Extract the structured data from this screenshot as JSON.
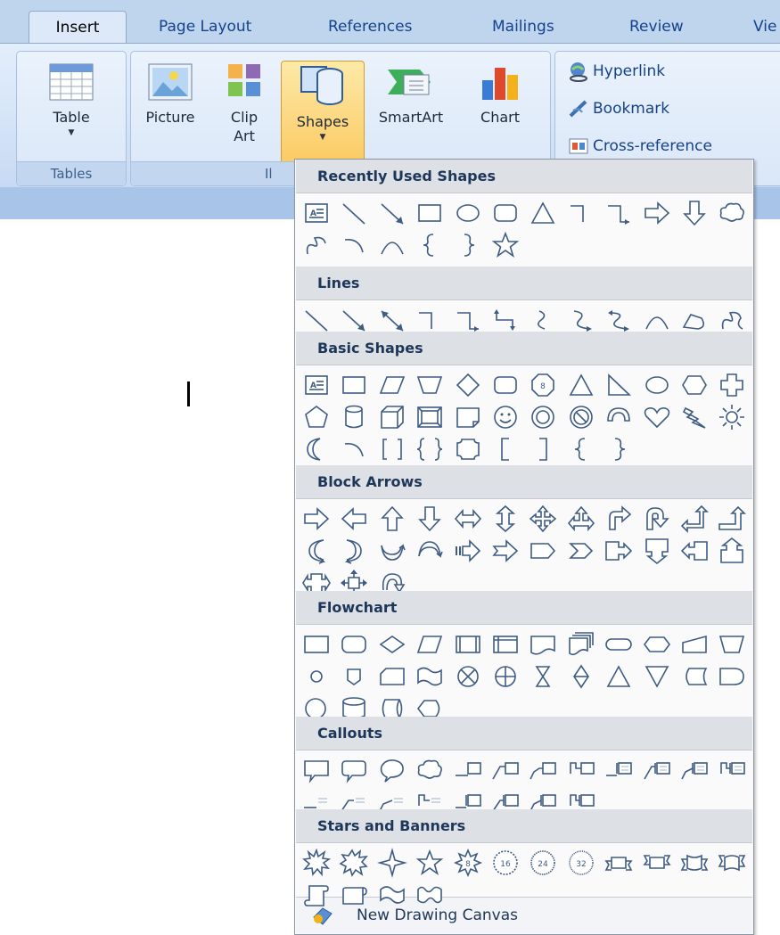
{
  "tabs": [
    {
      "label": "Insert",
      "active": true
    },
    {
      "label": "Page Layout"
    },
    {
      "label": "References"
    },
    {
      "label": "Mailings"
    },
    {
      "label": "Review"
    },
    {
      "label": "Vie"
    }
  ],
  "groups": {
    "tables": {
      "label": "Tables",
      "buttons": [
        {
          "label": "Table"
        }
      ]
    },
    "illustrations": {
      "label": "Il",
      "buttons": [
        {
          "label": "Picture"
        },
        {
          "label": "Clip Art"
        },
        {
          "label": "Shapes",
          "active": true
        },
        {
          "label": "SmartArt"
        },
        {
          "label": "Chart"
        }
      ]
    },
    "links": {
      "buttons": [
        {
          "label": "Hyperlink"
        },
        {
          "label": "Bookmark"
        },
        {
          "label": "Cross-reference"
        }
      ]
    }
  },
  "gallery": {
    "sections": [
      {
        "title": "Recently Used Shapes",
        "shapes": [
          "textbox",
          "line",
          "arrow",
          "rectangle",
          "oval",
          "rounded-rectangle",
          "triangle",
          "elbow-connector",
          "elbow-arrow-connector",
          "right-arrow",
          "down-arrow",
          "cloud-callout",
          "freeform-scribble",
          "arc",
          "curve",
          "left-brace",
          "right-brace",
          "star-5"
        ]
      },
      {
        "title": "Lines",
        "shapes": [
          "line",
          "arrow",
          "double-arrow",
          "elbow-connector",
          "elbow-arrow-connector",
          "elbow-double-arrow-connector",
          "curved-connector",
          "curved-arrow-connector",
          "curved-double-arrow-connector",
          "curve",
          "freeform",
          "scribble"
        ]
      },
      {
        "title": "Basic Shapes",
        "shapes": [
          "textbox",
          "rectangle",
          "parallelogram",
          "trapezoid",
          "diamond",
          "rounded-rectangle",
          "octagon",
          "triangle",
          "right-triangle",
          "oval",
          "hexagon",
          "cross",
          "pentagon",
          "can",
          "cube",
          "bevel",
          "folded-corner",
          "smiley-face",
          "donut",
          "no-symbol",
          "block-arc",
          "heart",
          "lightning-bolt",
          "sun",
          "moon",
          "arc",
          "double-bracket",
          "double-brace",
          "plaque",
          "left-bracket",
          "right-bracket",
          "left-brace",
          "right-brace"
        ]
      },
      {
        "title": "Block Arrows",
        "shapes": [
          "right-arrow",
          "left-arrow",
          "up-arrow",
          "down-arrow",
          "left-right-arrow",
          "up-down-arrow",
          "quad-arrow",
          "left-right-up-arrow",
          "bent-arrow",
          "u-turn-arrow",
          "left-up-arrow",
          "bent-up-arrow",
          "curved-right-arrow",
          "curved-left-arrow",
          "curved-up-arrow",
          "curved-down-arrow",
          "striped-right-arrow",
          "notched-right-arrow",
          "pentagon-arrow",
          "chevron",
          "right-arrow-callout",
          "down-arrow-callout",
          "left-arrow-callout",
          "up-arrow-callout",
          "left-right-arrow-callout",
          "quad-arrow-callout",
          "circular-arrow"
        ]
      },
      {
        "title": "Flowchart",
        "shapes": [
          "process",
          "alternate-process",
          "decision",
          "data",
          "predefined-process",
          "internal-storage",
          "document",
          "multidocument",
          "terminator",
          "preparation",
          "manual-input",
          "manual-operation",
          "connector",
          "off-page-connector",
          "card",
          "punched-tape",
          "summing-junction",
          "or",
          "collate",
          "sort",
          "extract",
          "merge",
          "stored-data",
          "delay",
          "sequential-access-storage",
          "magnetic-disk",
          "direct-access-storage",
          "display"
        ]
      },
      {
        "title": "Callouts",
        "shapes": [
          "rectangular-callout",
          "rounded-rectangular-callout",
          "oval-callout",
          "cloud-callout",
          "line-callout-1",
          "line-callout-2",
          "line-callout-3",
          "line-callout-4",
          "line-callout-1-accent",
          "line-callout-2-accent",
          "line-callout-3-accent",
          "line-callout-4-accent",
          "line-callout-1-no-border",
          "line-callout-2-no-border",
          "line-callout-3-no-border",
          "line-callout-4-no-border",
          "line-callout-1-border-accent",
          "line-callout-2-border-accent",
          "line-callout-3-border-accent",
          "line-callout-4-border-accent"
        ]
      },
      {
        "title": "Stars and Banners",
        "shapes": [
          "explosion-1",
          "explosion-2",
          "star-4",
          "star-5",
          "star-8",
          "star-16",
          "star-24",
          "star-32",
          "up-ribbon",
          "down-ribbon",
          "curved-up-ribbon",
          "curved-down-ribbon",
          "vertical-scroll",
          "horizontal-scroll",
          "wave",
          "double-wave"
        ]
      }
    ],
    "footer": {
      "label": "New Drawing Canvas",
      "icon": "drawing-canvas-icon"
    }
  }
}
